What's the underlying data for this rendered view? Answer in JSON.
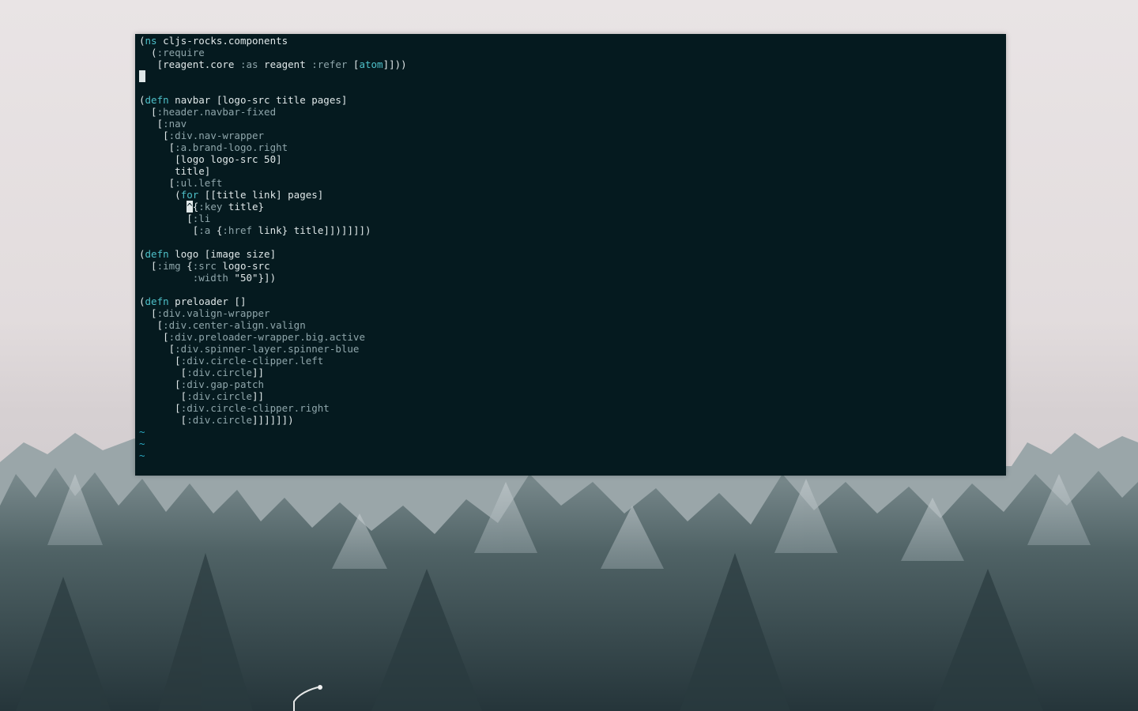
{
  "desktop": {
    "wallpaper": "misty frosted pine forest",
    "colors": {
      "sky_top": "#e9e4e5",
      "sky_bottom": "#d6d0d2",
      "forest_dark": "#2f4143",
      "forest_light": "#7f9194"
    }
  },
  "terminal": {
    "colors": {
      "background": "#051a1f",
      "foreground": "#dfe7e8",
      "keyword": "#4ec0c9",
      "symbol": "#8fa6ab",
      "tilde": "#2aa9c2"
    },
    "lines": [
      [
        {
          "t": "(",
          "c": "paren"
        },
        {
          "t": "ns",
          "c": "kw"
        },
        {
          "t": " cljs-rocks.components",
          "c": "plain"
        }
      ],
      [
        {
          "t": "  (",
          "c": "paren"
        },
        {
          "t": ":require",
          "c": "sym"
        }
      ],
      [
        {
          "t": "   [reagent.core ",
          "c": "plain"
        },
        {
          "t": ":as",
          "c": "sym"
        },
        {
          "t": " reagent ",
          "c": "plain"
        },
        {
          "t": ":refer",
          "c": "sym"
        },
        {
          "t": " [",
          "c": "plain"
        },
        {
          "t": "atom",
          "c": "kw"
        },
        {
          "t": "]]))",
          "c": "plain"
        }
      ],
      [
        {
          "t": " ",
          "c": "cursor"
        }
      ],
      [],
      [
        {
          "t": "(",
          "c": "paren"
        },
        {
          "t": "defn",
          "c": "kw"
        },
        {
          "t": " navbar [logo-src title pages]",
          "c": "plain"
        }
      ],
      [
        {
          "t": "  [",
          "c": "paren"
        },
        {
          "t": ":header.navbar-fixed",
          "c": "sym"
        }
      ],
      [
        {
          "t": "   [",
          "c": "paren"
        },
        {
          "t": ":nav",
          "c": "sym"
        }
      ],
      [
        {
          "t": "    [",
          "c": "paren"
        },
        {
          "t": ":div.nav-wrapper",
          "c": "sym"
        }
      ],
      [
        {
          "t": "     [",
          "c": "paren"
        },
        {
          "t": ":a.brand-logo.right",
          "c": "sym"
        }
      ],
      [
        {
          "t": "      [logo logo-src 50]",
          "c": "plain"
        }
      ],
      [
        {
          "t": "      title]",
          "c": "plain"
        }
      ],
      [
        {
          "t": "     [",
          "c": "paren"
        },
        {
          "t": ":ul.left",
          "c": "sym"
        }
      ],
      [
        {
          "t": "      (",
          "c": "paren"
        },
        {
          "t": "for",
          "c": "kw"
        },
        {
          "t": " [[title link] pages]",
          "c": "plain"
        }
      ],
      [
        {
          "t": "        ",
          "c": "plain"
        },
        {
          "t": "^",
          "c": "cursor"
        },
        {
          "t": "{",
          "c": "plain"
        },
        {
          "t": ":key",
          "c": "sym"
        },
        {
          "t": " title}",
          "c": "plain"
        }
      ],
      [
        {
          "t": "        [",
          "c": "paren"
        },
        {
          "t": ":li",
          "c": "sym"
        }
      ],
      [
        {
          "t": "         [",
          "c": "paren"
        },
        {
          "t": ":a",
          "c": "sym"
        },
        {
          "t": " {",
          "c": "plain"
        },
        {
          "t": ":href",
          "c": "sym"
        },
        {
          "t": " link} title]])]]]])",
          "c": "plain"
        }
      ],
      [],
      [
        {
          "t": "(",
          "c": "paren"
        },
        {
          "t": "defn",
          "c": "kw"
        },
        {
          "t": " logo [image size]",
          "c": "plain"
        }
      ],
      [
        {
          "t": "  [",
          "c": "paren"
        },
        {
          "t": ":img",
          "c": "sym"
        },
        {
          "t": " {",
          "c": "plain"
        },
        {
          "t": ":src",
          "c": "sym"
        },
        {
          "t": " logo-src",
          "c": "plain"
        }
      ],
      [
        {
          "t": "         ",
          "c": "plain"
        },
        {
          "t": ":width",
          "c": "sym"
        },
        {
          "t": " \"50\"}])",
          "c": "plain"
        }
      ],
      [],
      [
        {
          "t": "(",
          "c": "paren"
        },
        {
          "t": "defn",
          "c": "kw"
        },
        {
          "t": " preloader []",
          "c": "plain"
        }
      ],
      [
        {
          "t": "  [",
          "c": "paren"
        },
        {
          "t": ":div.valign-wrapper",
          "c": "sym"
        }
      ],
      [
        {
          "t": "   [",
          "c": "paren"
        },
        {
          "t": ":div.center-align.valign",
          "c": "sym"
        }
      ],
      [
        {
          "t": "    [",
          "c": "paren"
        },
        {
          "t": ":div.preloader-wrapper.big.active",
          "c": "sym"
        }
      ],
      [
        {
          "t": "     [",
          "c": "paren"
        },
        {
          "t": ":div.spinner-layer.spinner-blue",
          "c": "sym"
        }
      ],
      [
        {
          "t": "      [",
          "c": "paren"
        },
        {
          "t": ":div.circle-clipper.left",
          "c": "sym"
        }
      ],
      [
        {
          "t": "       [",
          "c": "paren"
        },
        {
          "t": ":div.circle",
          "c": "sym"
        },
        {
          "t": "]]",
          "c": "plain"
        }
      ],
      [
        {
          "t": "      [",
          "c": "paren"
        },
        {
          "t": ":div.gap-patch",
          "c": "sym"
        }
      ],
      [
        {
          "t": "       [",
          "c": "paren"
        },
        {
          "t": ":div.circle",
          "c": "sym"
        },
        {
          "t": "]]",
          "c": "plain"
        }
      ],
      [
        {
          "t": "      [",
          "c": "paren"
        },
        {
          "t": ":div.circle-clipper.right",
          "c": "sym"
        }
      ],
      [
        {
          "t": "       [",
          "c": "paren"
        },
        {
          "t": ":div.circle",
          "c": "sym"
        },
        {
          "t": "]]]]]])",
          "c": "plain"
        }
      ],
      [
        {
          "t": "~",
          "c": "tilde"
        }
      ],
      [
        {
          "t": "~",
          "c": "tilde"
        }
      ],
      [
        {
          "t": "~",
          "c": "tilde"
        }
      ]
    ]
  }
}
